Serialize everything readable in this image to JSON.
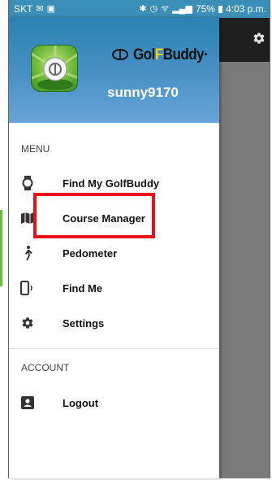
{
  "status_bar": {
    "carrier": "SKT",
    "battery_percent": "75%",
    "time": "4:03 p.m."
  },
  "drawer": {
    "brand": {
      "part1": "Gol",
      "part2": "F",
      "part3": "Buddy",
      "trademark": "·"
    },
    "username": "sunny9170",
    "menu_section": "MENU",
    "menu_items": [
      {
        "label": "Find My GolfBuddy",
        "icon": "watch-icon"
      },
      {
        "label": "Course Manager",
        "icon": "map-icon"
      },
      {
        "label": "Pedometer",
        "icon": "walking-icon"
      },
      {
        "label": "Find Me",
        "icon": "phone-ring-icon"
      },
      {
        "label": "Settings",
        "icon": "gear-icon"
      }
    ],
    "account_section": "ACCOUNT",
    "account_items": [
      {
        "label": "Logout",
        "icon": "account-box-icon"
      }
    ]
  },
  "colors": {
    "header_gradient_top": "#2b82b2",
    "status_bar": "#3a8fb8",
    "highlight": "#e8101a",
    "dim_overlay": "#7a7a7a"
  }
}
